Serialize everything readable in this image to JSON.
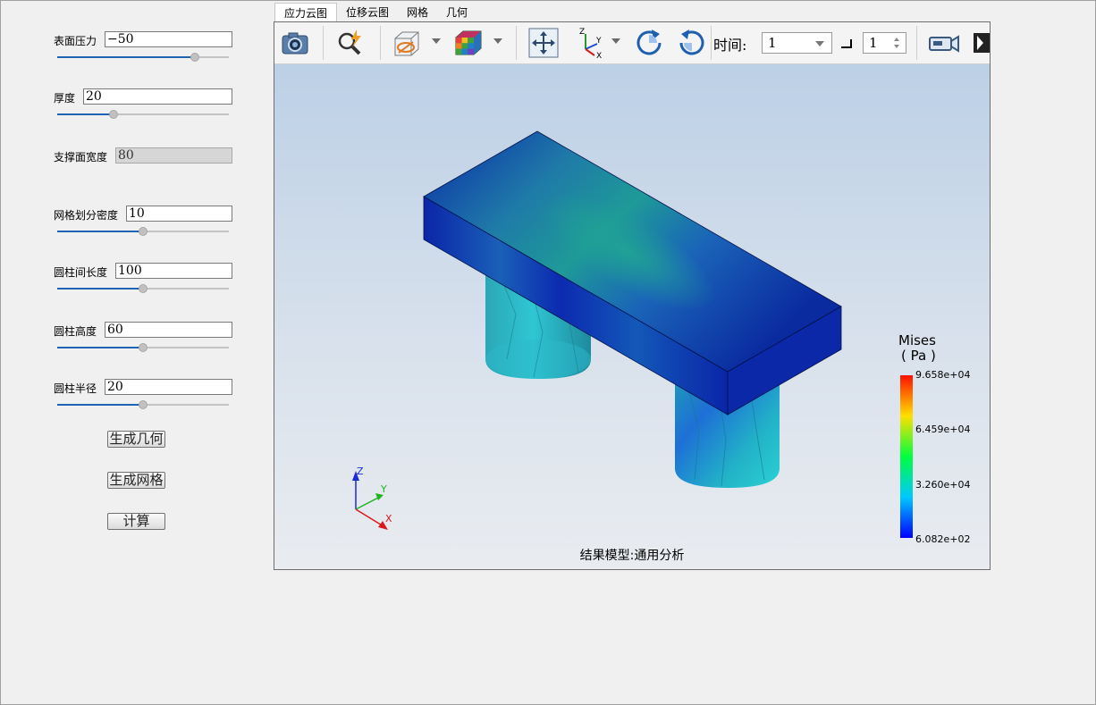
{
  "params": [
    {
      "label": "表面压力",
      "value": "−50",
      "slider": 0.8
    },
    {
      "label": "厚度",
      "value": "20",
      "slider": 0.33
    },
    {
      "label": "支撑面宽度",
      "value": "80",
      "disabled": true
    },
    {
      "label": "网格划分密度",
      "value": "10",
      "slider": 0.5
    },
    {
      "label": "圆柱间长度",
      "value": "100",
      "slider": 0.5
    },
    {
      "label": "圆柱高度",
      "value": "60",
      "slider": 0.5
    },
    {
      "label": "圆柱半径",
      "value": "20",
      "slider": 0.5
    }
  ],
  "buttons": {
    "generate_geometry": "生成几何",
    "generate_mesh": "生成网格",
    "compute": "计算"
  },
  "tabs": [
    "应力云图",
    "位移云图",
    "网格",
    "几何"
  ],
  "toolbar": {
    "time_label": "时间:",
    "time_value": "1",
    "step_value": "1"
  },
  "viewer": {
    "result_label": "结果模型:通用分析",
    "axes": {
      "z": "Z",
      "y": "Y",
      "x": "X"
    }
  },
  "legend": {
    "title": "Mises",
    "unit": "( Pa )",
    "values": [
      "9.658e+04",
      "6.459e+04",
      "3.260e+04",
      "6.082e+02"
    ]
  },
  "colors": {
    "slider_fill": "#1f63b3",
    "viewer_bg_top": "#bcd0e6",
    "viewer_bg_bottom": "#e9ecf0"
  }
}
